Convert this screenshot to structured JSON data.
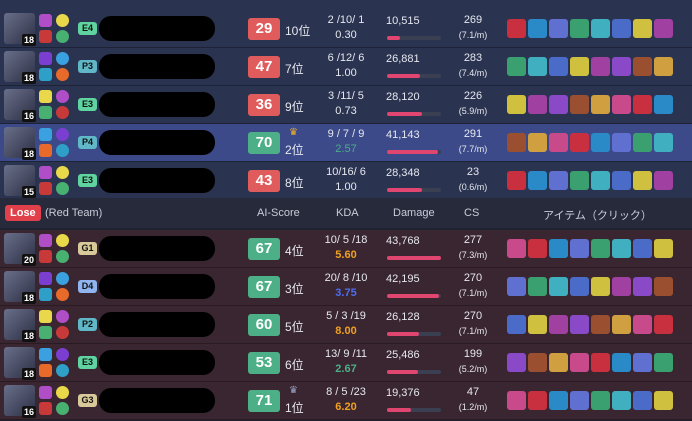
{
  "lose_header": {
    "result": "Lose",
    "team": "(Red Team)",
    "columns": {
      "score": "AI-Score",
      "kda": "KDA",
      "damage": "Damage",
      "cs": "CS",
      "items": "アイテム（クリック）"
    }
  },
  "colors": {
    "green_score": "#4caf87",
    "red_score": "#e05b5b",
    "ratio_green": "#4caf87",
    "ratio_blue": "#4c6ef0",
    "ratio_orange": "#f0a020",
    "damage_bar": "#e0466f"
  },
  "win_rows": [
    {
      "level": "18",
      "rank": "E4",
      "score": "29",
      "place": "10位",
      "kda": "2 /10/ 1",
      "ratio": "0.30",
      "damage": "10,515",
      "damage_pct": 0.24,
      "cs": "269",
      "cs_pm": "(7.1/m)",
      "good": false,
      "crown": false,
      "hl": false
    },
    {
      "level": "18",
      "rank": "P3",
      "score": "47",
      "place": "7位",
      "kda": "6 /12/ 6",
      "ratio": "1.00",
      "damage": "26,881",
      "damage_pct": 0.61,
      "cs": "283",
      "cs_pm": "(7.4/m)",
      "good": false,
      "crown": false,
      "hl": false
    },
    {
      "level": "16",
      "rank": "E3",
      "score": "36",
      "place": "9位",
      "kda": "3 /11/ 5",
      "ratio": "0.73",
      "damage": "28,120",
      "damage_pct": 0.64,
      "cs": "226",
      "cs_pm": "(5.9/m)",
      "good": false,
      "crown": false,
      "hl": false
    },
    {
      "level": "18",
      "rank": "P4",
      "score": "70",
      "place": "2位",
      "kda": "9 / 7 / 9",
      "ratio": "2.57",
      "damage": "41,143",
      "damage_pct": 0.94,
      "cs": "291",
      "cs_pm": "(7.7/m)",
      "good": true,
      "crown": true,
      "hl": true
    },
    {
      "level": "15",
      "rank": "E3",
      "score": "43",
      "place": "8位",
      "kda": "10/16/ 6",
      "ratio": "1.00",
      "damage": "28,348",
      "damage_pct": 0.65,
      "cs": "23",
      "cs_pm": "(0.6/m)",
      "good": false,
      "crown": false,
      "hl": false
    }
  ],
  "lose_rows": [
    {
      "level": "20",
      "rank": "G1",
      "score": "67",
      "place": "4位",
      "kda": "10/ 5 /18",
      "ratio": "5.60",
      "ratio_color": "orange",
      "damage": "43,768",
      "damage_pct": 1.0,
      "cs": "277",
      "cs_pm": "(7.3/m)",
      "crown": false
    },
    {
      "level": "18",
      "rank": "D4",
      "score": "67",
      "place": "3位",
      "kda": "20/ 8 /10",
      "ratio": "3.75",
      "ratio_color": "blue",
      "damage": "42,195",
      "damage_pct": 0.96,
      "cs": "270",
      "cs_pm": "(7.1/m)",
      "crown": false
    },
    {
      "level": "18",
      "rank": "P2",
      "score": "60",
      "place": "5位",
      "kda": "5 / 3 /19",
      "ratio": "8.00",
      "ratio_color": "orange",
      "damage": "26,128",
      "damage_pct": 0.6,
      "cs": "270",
      "cs_pm": "(7.1/m)",
      "crown": false
    },
    {
      "level": "18",
      "rank": "E3",
      "score": "53",
      "place": "6位",
      "kda": "13/ 9 /11",
      "ratio": "2.67",
      "ratio_color": "green",
      "damage": "25,486",
      "damage_pct": 0.58,
      "cs": "199",
      "cs_pm": "(5.2/m)",
      "crown": false
    },
    {
      "level": "16",
      "rank": "G3",
      "score": "71",
      "place": "1位",
      "kda": "8 / 5 /23",
      "ratio": "6.20",
      "ratio_color": "orange",
      "damage": "19,376",
      "damage_pct": 0.44,
      "cs": "47",
      "cs_pm": "(1.2/m)",
      "crown": true
    }
  ]
}
